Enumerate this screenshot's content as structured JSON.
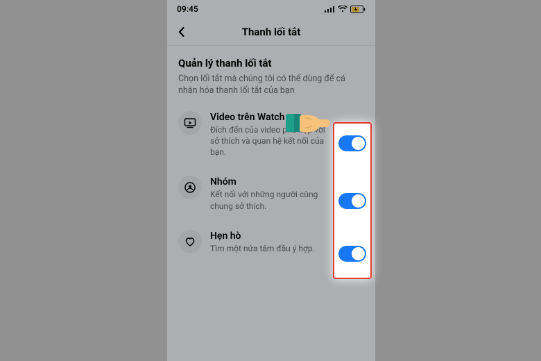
{
  "statusbar": {
    "time": "09:45"
  },
  "header": {
    "title": "Thanh lối tắt"
  },
  "section": {
    "title": "Quản lý thanh lối tắt",
    "subtitle": "Chọn lối tắt mà chúng tôi có thể dùng để cá nhân hóa thanh lối tắt của bạn"
  },
  "rows": [
    {
      "title": "Video trên Watch",
      "desc": "Đích đến của video phù hợp với sở thích và quan hệ kết nối của bạn.",
      "enabled": true
    },
    {
      "title": "Nhóm",
      "desc": "Kết nối với những người cùng chung sở thích.",
      "enabled": true
    },
    {
      "title": "Hẹn hò",
      "desc": "Tìm một nửa tâm đầu ý hợp.",
      "enabled": true
    }
  ]
}
